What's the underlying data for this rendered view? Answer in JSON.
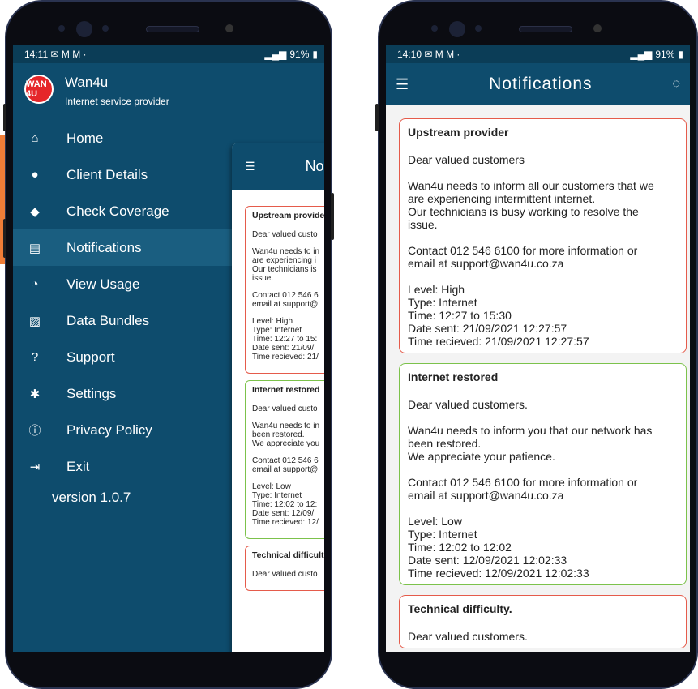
{
  "colors": {
    "header": "#0e4c6d",
    "high": "#e55b4b",
    "low": "#7cc24b",
    "accent": "#ef7d37"
  },
  "left_phone": {
    "status": {
      "time": "14:11",
      "icons": "✉ M M ·",
      "battery": "91%"
    },
    "brand": {
      "logo": "WAN 4U",
      "name": "Wan4u",
      "subtitle": "Internet service provider"
    },
    "menu": [
      {
        "icon": "home-icon",
        "glyph": "⌂",
        "label": "Home"
      },
      {
        "icon": "person-icon",
        "glyph": "●",
        "label": "Client Details"
      },
      {
        "icon": "location-pin-icon",
        "glyph": "◆",
        "label": "Check Coverage"
      },
      {
        "icon": "chat-icon",
        "glyph": "▤",
        "label": "Notifications"
      },
      {
        "icon": "data-usage-icon",
        "glyph": "◔",
        "label": "View Usage"
      },
      {
        "icon": "cart-icon",
        "glyph": "▨",
        "label": "Data Bundles"
      },
      {
        "icon": "help-icon",
        "glyph": "?",
        "label": "Support"
      },
      {
        "icon": "gear-icon",
        "glyph": "✱",
        "label": "Settings"
      },
      {
        "icon": "info-icon",
        "glyph": "ⓘ",
        "label": "Privacy Policy"
      },
      {
        "icon": "exit-icon",
        "glyph": "⇥",
        "label": "Exit"
      }
    ],
    "version": "version 1.0.7",
    "peek_title": "No",
    "peek_cards": [
      {
        "title": "Upstream provide",
        "p1": "Dear valued custo",
        "p2": "Wan4u needs to in\nare experiencing i\nOur technicians is\nissue.",
        "p3": "Contact 012 546 6\nemail at support@",
        "p4": "Level: High\nType: Internet\nTime: 12:27 to 15:\nDate sent: 21/09/\nTime recieved: 21/"
      },
      {
        "title": "Internet restored",
        "p1": "Dear valued custo",
        "p2": "Wan4u needs to in\nbeen restored.\nWe appreciate you",
        "p3": "Contact 012 546 6\nemail at support@",
        "p4": "Level: Low\nType: Internet\nTime: 12:02 to 12:\nDate sent: 12/09/\nTime recieved: 12/"
      },
      {
        "title": "Technical difficult",
        "p1": "Dear valued custo",
        "p2": "",
        "p3": "",
        "p4": ""
      }
    ]
  },
  "right_phone": {
    "status": {
      "time": "14:10",
      "icons": "✉ M M ·",
      "battery": "91%"
    },
    "title": "Notifications",
    "cards": [
      {
        "title": "Upstream provider",
        "greeting": "Dear valued customers",
        "body": "Wan4u needs to inform all our customers that we\nare experiencing intermittent internet.\nOur technicians is busy working to resolve the\nissue.",
        "contact": "Contact 012 546 6100 for more information or\nemail at support@wan4u.co.za",
        "details": "Level: High\nType: Internet\nTime: 12:27 to 15:30\nDate sent: 21/09/2021 12:27:57\nTime recieved: 21/09/2021 12:27:57"
      },
      {
        "title": "Internet restored",
        "greeting": "Dear valued customers.",
        "body": "Wan4u needs to inform you that our network has\nbeen restored.\nWe appreciate your patience.",
        "contact": "Contact 012 546 6100 for more information or\nemail at support@wan4u.co.za",
        "details": "Level: Low\nType: Internet\nTime: 12:02 to 12:02\nDate sent: 12/09/2021 12:02:33\nTime recieved: 12/09/2021 12:02:33"
      },
      {
        "title": "Technical difficulty.",
        "greeting": "Dear valued customers.",
        "body": "",
        "contact": "",
        "details": ""
      }
    ]
  }
}
